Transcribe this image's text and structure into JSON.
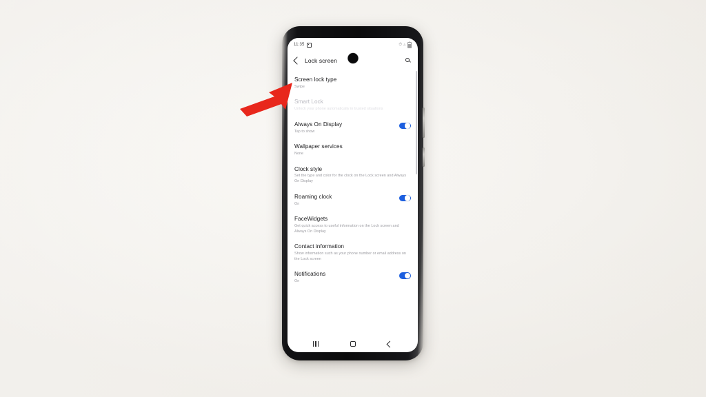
{
  "scene": {
    "background_color": "#f7f5f2",
    "device": "smartphone",
    "annotation": {
      "type": "arrow",
      "color": "#e8271c",
      "points_to": "Screen lock type"
    }
  },
  "status_bar": {
    "time": "11:35",
    "alarm_icon": "alarm-icon",
    "signal_icon": "signal-icon",
    "wifi_icon": "wifi-icon",
    "battery_icon": "battery-icon"
  },
  "app_bar": {
    "back_icon": "back-chevron-icon",
    "title": "Lock screen",
    "search_icon": "search-icon"
  },
  "settings": {
    "items": [
      {
        "title": "Screen lock type",
        "subtitle": "Swipe",
        "toggle": null,
        "disabled": false
      },
      {
        "title": "Smart Lock",
        "subtitle": "Unlock your phone automatically in trusted situations",
        "toggle": null,
        "disabled": true
      },
      {
        "title": "Always On Display",
        "subtitle": "Tap to show",
        "toggle": "on",
        "disabled": false
      },
      {
        "title": "Wallpaper services",
        "subtitle": "None",
        "toggle": null,
        "disabled": false
      },
      {
        "title": "Clock style",
        "subtitle": "Set the type and color for the clock on the Lock screen and Always On Display",
        "toggle": null,
        "disabled": false
      },
      {
        "title": "Roaming clock",
        "subtitle": "On",
        "toggle": "on",
        "disabled": false
      },
      {
        "title": "FaceWidgets",
        "subtitle": "Get quick access to useful information on the Lock screen and Always On Display",
        "toggle": null,
        "disabled": false
      },
      {
        "title": "Contact information",
        "subtitle": "Show information such as your phone number or email address on the Lock screen",
        "toggle": null,
        "disabled": false
      },
      {
        "title": "Notifications",
        "subtitle": "On",
        "toggle": "on",
        "disabled": false
      }
    ]
  },
  "nav_bar": {
    "recents_label": "recents-icon",
    "home_label": "home-icon",
    "back_label": "back-icon"
  },
  "colors": {
    "accent": "#1c5fe0",
    "arrow": "#e8271c",
    "title_text": "#1a1a1c",
    "subtitle_text": "#9a9aa0",
    "disabled_text": "#b9b9c0"
  }
}
